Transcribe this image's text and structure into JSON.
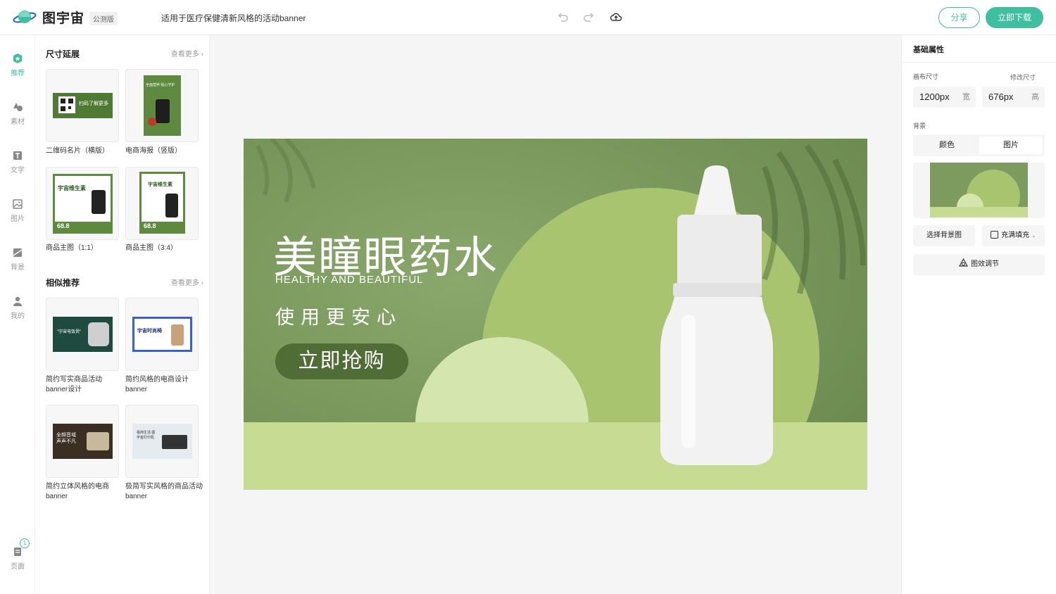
{
  "header": {
    "logo_text": "图宇宙",
    "beta_label": "公测版",
    "doc_title": "适用于医疗保健清新风格的活动banner",
    "share_label": "分享",
    "download_label": "立即下载"
  },
  "nav": {
    "items": [
      {
        "label": "推荐",
        "icon": "recommend-icon"
      },
      {
        "label": "素材",
        "icon": "shapes-icon"
      },
      {
        "label": "文字",
        "icon": "text-icon"
      },
      {
        "label": "图片",
        "icon": "image-icon"
      },
      {
        "label": "背景",
        "icon": "background-icon"
      },
      {
        "label": "我的",
        "icon": "user-icon"
      }
    ],
    "pages_label": "页面",
    "pages_count": "1"
  },
  "panel": {
    "size_section": {
      "title": "尺寸延展",
      "more": "查看更多",
      "cards": [
        {
          "label": "二维码名片（横版）",
          "thumb_text": "扫码了解更多"
        },
        {
          "label": "电商海报（竖版）",
          "thumb_text": "全面营养 贴心守护"
        },
        {
          "label": "商品主图（1:1）",
          "thumb_text": "宇宙维生素",
          "price": "68.8"
        },
        {
          "label": "商品主图（3:4）",
          "thumb_text": "宇宙维生素",
          "price": "68.8"
        }
      ]
    },
    "similar_section": {
      "title": "相似推荐",
      "more": "查看更多",
      "cards": [
        {
          "label": "简约写实商品活动banner设计",
          "thumb_text": "\"宇宙电饭煲\""
        },
        {
          "label": "简约风格的电商设计banner",
          "thumb_text": "宇宙时尚椅"
        },
        {
          "label": "简约立体风格的电商banner",
          "thumb_text": "全频音域 声声不凡"
        },
        {
          "label": "极简写实风格的商品活动banner",
          "thumb_text": "极简生活 图宇宙打印机"
        }
      ]
    }
  },
  "banner": {
    "title": "美瞳眼药水",
    "subtitle": "HEALTHY AND BEAUTIFUL",
    "slogan": "使用更安心",
    "cta": "立即抢购"
  },
  "properties": {
    "title": "基础属性",
    "canvas_size_label": "画布尺寸",
    "resize_link": "修改尺寸",
    "width_value": "1200px",
    "width_unit": "宽",
    "height_value": "676px",
    "height_unit": "高",
    "background_label": "背景",
    "tab_color": "颜色",
    "tab_image": "图片",
    "select_bg": "选择背景图",
    "fill_mode": "充满填充",
    "effect_adjust": "图效调节"
  },
  "colors": {
    "accent": "#3fbf9f",
    "banner_green": "#7d9a5f",
    "lime": "#c8db92"
  }
}
